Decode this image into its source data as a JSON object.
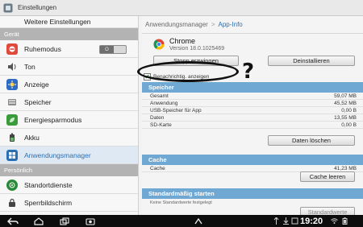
{
  "topbar": {
    "title": "Einstellungen"
  },
  "sidebar": {
    "top_item": "Weitere Einstellungen",
    "sections": [
      {
        "header": "Gerät",
        "items": [
          {
            "label": "Ruhemodus",
            "icon": "moon-icon",
            "color": "#e04a3a"
          },
          {
            "label": "Ton",
            "icon": "speaker-icon",
            "color": "#555555"
          },
          {
            "label": "Anzeige",
            "icon": "display-icon",
            "color": "#2f6cc2"
          },
          {
            "label": "Speicher",
            "icon": "storage-icon",
            "color": "#777777"
          },
          {
            "label": "Energiesparmodus",
            "icon": "battery-saver-icon",
            "color": "#3b9c3b"
          },
          {
            "label": "Akku",
            "icon": "battery-icon",
            "color": "#444444"
          },
          {
            "label": "Anwendungsmanager",
            "icon": "apps-icon",
            "color": "#2b6fb2"
          }
        ]
      },
      {
        "header": "Persönlich",
        "items": [
          {
            "label": "Standortdienste",
            "icon": "location-icon",
            "color": "#2a8a3a"
          },
          {
            "label": "Sperrbildschirm",
            "icon": "lock-icon",
            "color": "#444444"
          }
        ]
      }
    ]
  },
  "breadcrumb": {
    "parent": "Anwendungsmanager",
    "current": "App-Info"
  },
  "app": {
    "name": "Chrome",
    "version": "Version 18.0.1025469"
  },
  "buttons": {
    "stop": "Stopp erzwingen",
    "uninstall": "Deinstallieren",
    "clear_data": "Daten löschen",
    "clear_cache": "Cache leeren",
    "defaults": "Standardwerte"
  },
  "notify": {
    "label": "Benachrichtig. anzeigen"
  },
  "storage": {
    "header": "Speicher",
    "rows": [
      {
        "k": "Gesamt",
        "v": "59,07 MB"
      },
      {
        "k": "Anwendung",
        "v": "45,52 MB"
      },
      {
        "k": "USB-Speicher für App",
        "v": "0,00 B"
      },
      {
        "k": "Daten",
        "v": "13,55 MB"
      },
      {
        "k": "SD-Karte",
        "v": "0,00 B"
      }
    ]
  },
  "cache": {
    "header": "Cache",
    "rows": [
      {
        "k": "Cache",
        "v": "41,23 MB"
      }
    ]
  },
  "defaults": {
    "header": "Standardmäßig starten",
    "hint": "Keine Standardwerte festgelegt"
  },
  "annotation": {
    "mark": "?"
  },
  "statusbar": {
    "time": "19:20"
  },
  "colors": {
    "accent": "#2b6fb2",
    "section_header": "#6fa8d3"
  }
}
